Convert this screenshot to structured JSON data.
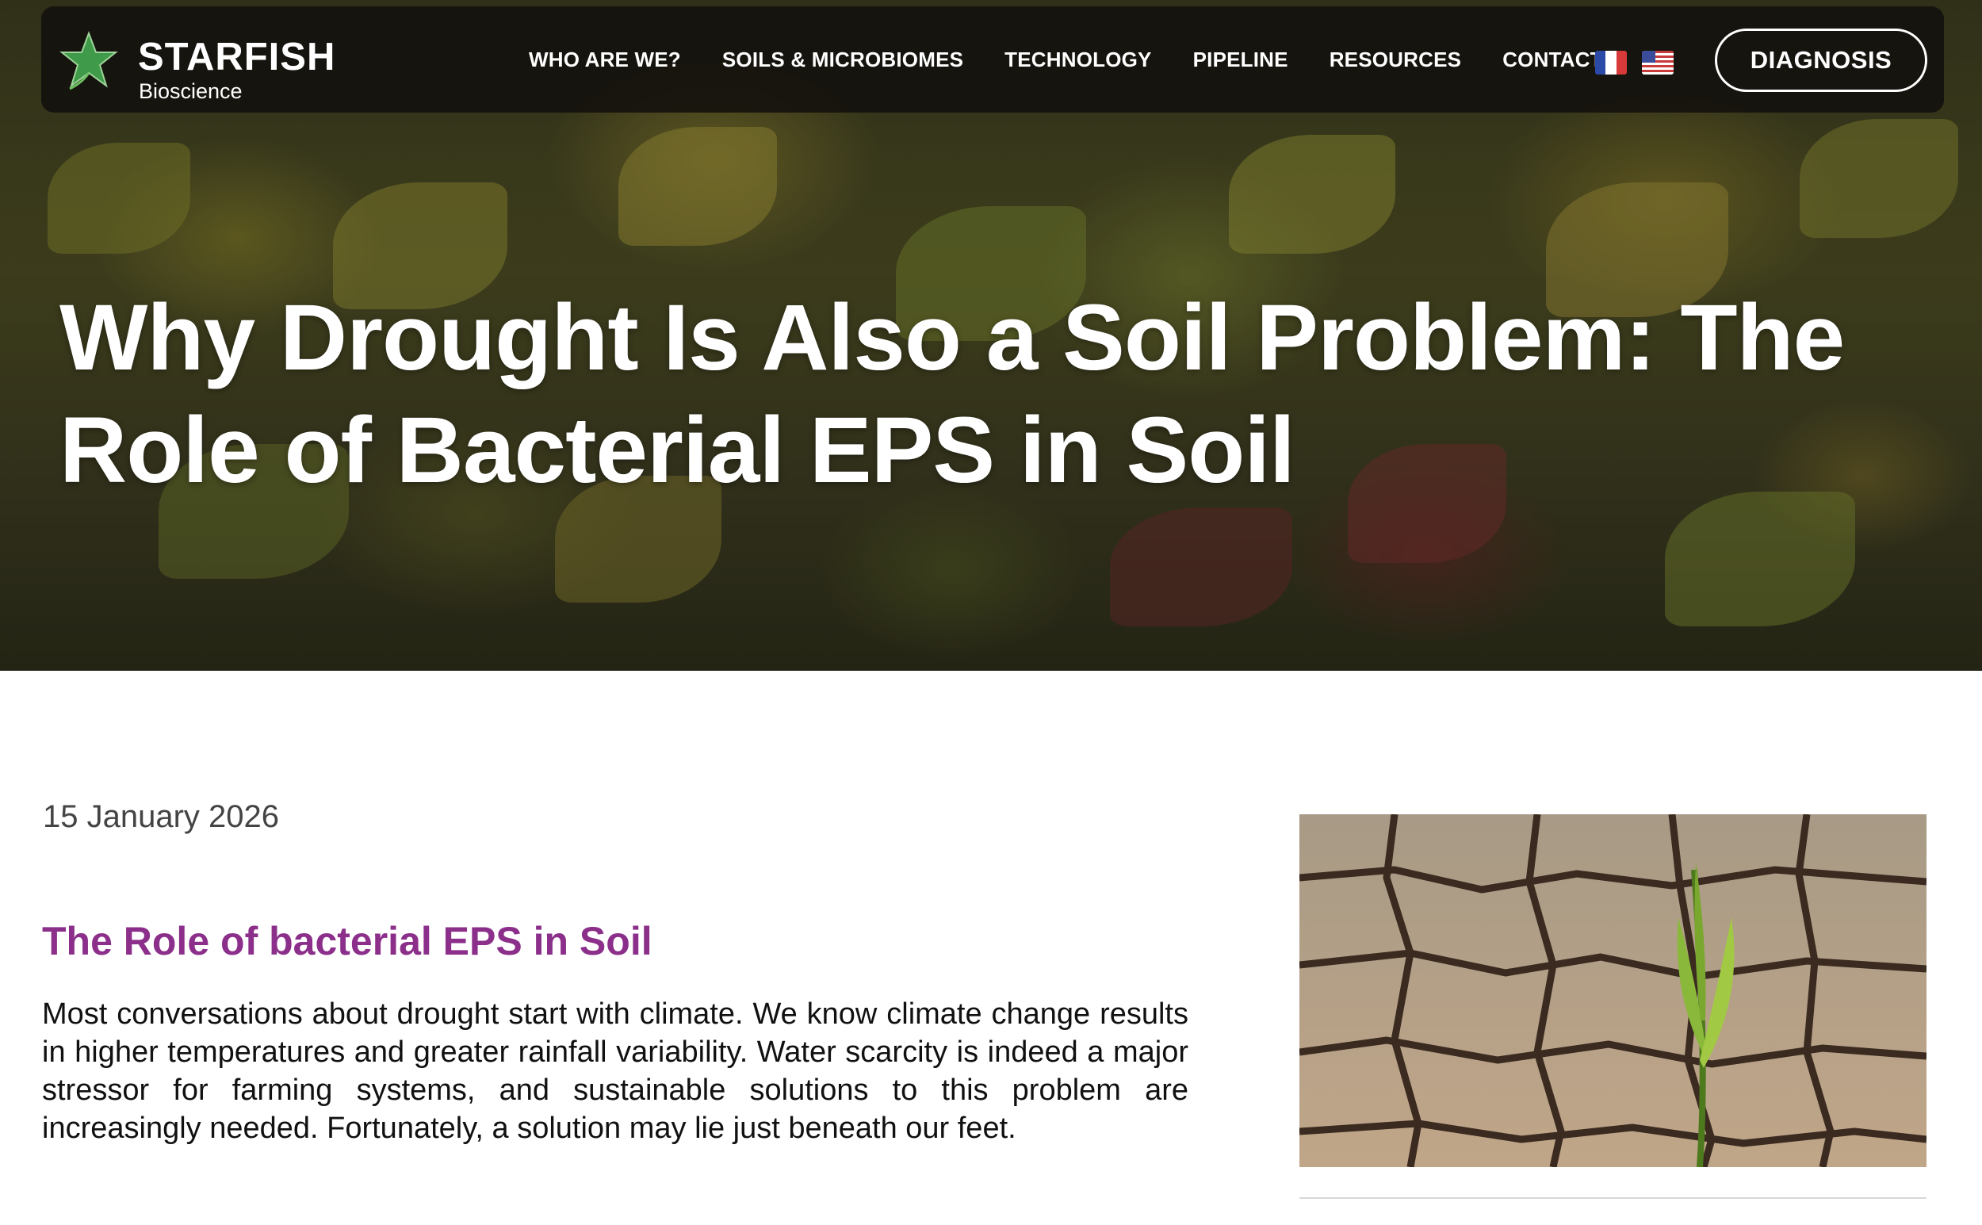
{
  "brand": {
    "name": "STARFISH",
    "tagline": "Bioscience",
    "logo_icon": "starfish-leaf-icon"
  },
  "nav": {
    "items": [
      {
        "label": "WHO ARE WE?"
      },
      {
        "label": "SOILS & MICROBIOMES"
      },
      {
        "label": "TECHNOLOGY"
      },
      {
        "label": "PIPELINE"
      },
      {
        "label": "RESOURCES"
      },
      {
        "label": "CONTACT"
      }
    ],
    "languages": [
      {
        "icon": "french-flag-icon"
      },
      {
        "icon": "us-flag-icon"
      }
    ],
    "cta_label": "DIAGNOSIS"
  },
  "hero": {
    "title": "Why Drought Is Also a Soil Problem: The Role of Bacterial EPS in Soil"
  },
  "article": {
    "date": "15 January 2026",
    "section_title": "The Role of bacterial EPS in Soil",
    "paragraph": "Most conversations about drought start with climate. We know climate change results in higher temperatures and greater rainfall variability. Water scarcity is indeed a major stressor for farming systems, and sustainable solutions to this problem are increasingly needed. Fortunately, a solution may lie just beneath our feet."
  },
  "colors": {
    "accent_purple": "#8b2f8b",
    "nav_bg": "#121010",
    "text": "#111111"
  }
}
